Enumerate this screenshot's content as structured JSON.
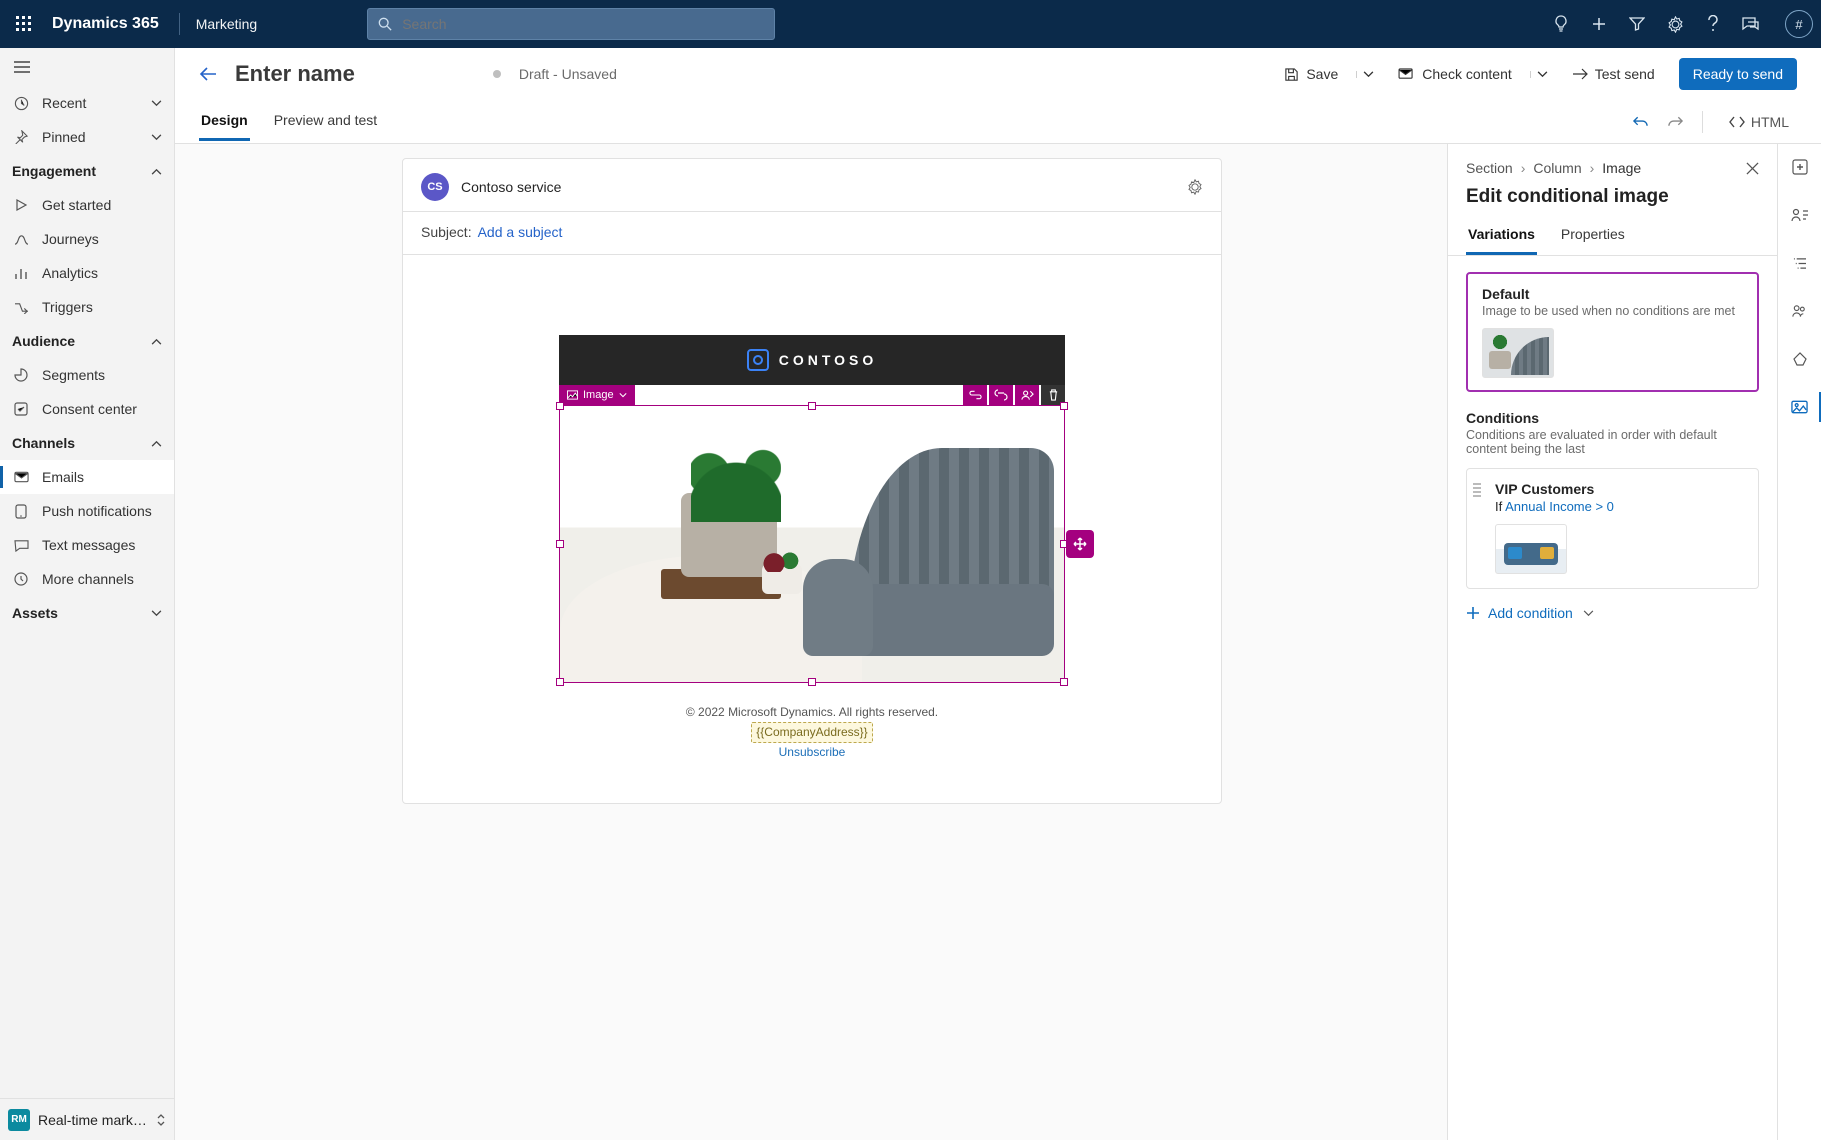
{
  "header": {
    "brand": "Dynamics 365",
    "app": "Marketing",
    "search_placeholder": "Search",
    "avatar_text": "#"
  },
  "nav": {
    "recent": "Recent",
    "pinned": "Pinned",
    "groups": {
      "engagement": {
        "title": "Engagement",
        "get_started": "Get started",
        "journeys": "Journeys",
        "analytics": "Analytics",
        "triggers": "Triggers"
      },
      "audience": {
        "title": "Audience",
        "segments": "Segments",
        "consent": "Consent center"
      },
      "channels": {
        "title": "Channels",
        "emails": "Emails",
        "push": "Push notifications",
        "text": "Text messages",
        "more": "More channels"
      },
      "assets": {
        "title": "Assets"
      }
    },
    "area": {
      "badge": "RM",
      "label": "Real-time marketi…"
    }
  },
  "page": {
    "title": "Enter name",
    "status": "Draft - Unsaved",
    "actions": {
      "save": "Save",
      "check": "Check content",
      "test": "Test send",
      "ready": "Ready to send"
    },
    "tabs": {
      "design": "Design",
      "preview": "Preview and test",
      "html": "HTML"
    }
  },
  "canvas": {
    "sender_badge": "CS",
    "sender": "Contoso service",
    "subject_label": "Subject:",
    "subject_placeholder": "Add a subject",
    "brand": "CONTOSO",
    "chip": "Image",
    "footer_copy": "© 2022 Microsoft Dynamics. All rights reserved.",
    "footer_addr": "{{CompanyAddress}}",
    "footer_unsub": "Unsubscribe"
  },
  "panel": {
    "breadcrumb": {
      "a": "Section",
      "b": "Column",
      "c": "Image"
    },
    "title": "Edit conditional image",
    "tabs": {
      "variations": "Variations",
      "properties": "Properties"
    },
    "default": {
      "name": "Default",
      "desc": "Image to be used when no conditions are met"
    },
    "conditions": {
      "title": "Conditions",
      "desc": "Conditions are evaluated in order with default content being the last",
      "item": {
        "name": "VIP Customers",
        "if": "If",
        "expr": "Annual Income > 0"
      },
      "add": "Add condition"
    }
  }
}
